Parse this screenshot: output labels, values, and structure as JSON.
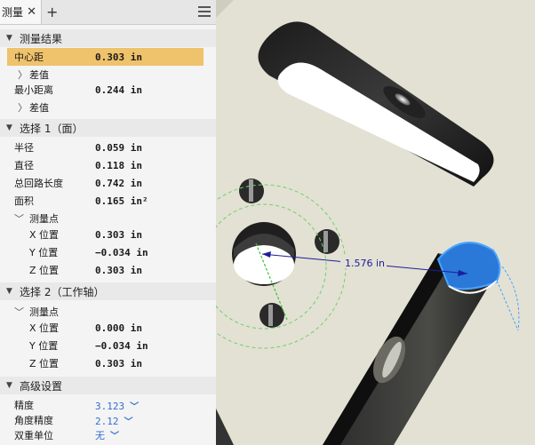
{
  "tab": {
    "label": "测量",
    "close": "✕",
    "add": "+"
  },
  "results": {
    "title": "测量结果",
    "center_distance_label": "中心距",
    "center_distance_value": "0.303 in",
    "diff_label_1": "差值",
    "min_distance_label": "最小距离",
    "min_distance_value": "0.244 in",
    "diff_label_2": "差值"
  },
  "sel1": {
    "title": "选择 1（面）",
    "radius_label": "半径",
    "radius_value": "0.059 in",
    "diameter_label": "直径",
    "diameter_value": "0.118 in",
    "loop_label": "总回路长度",
    "loop_value": "0.742 in",
    "area_label": "面积",
    "area_value": "0.165 in²",
    "points_label": "测量点",
    "x_label": "X 位置",
    "x_value": "0.303 in",
    "y_label": "Y 位置",
    "y_value": "−0.034 in",
    "z_label": "Z 位置",
    "z_value": "0.303 in"
  },
  "sel2": {
    "title": "选择 2（工作轴）",
    "points_label": "测量点",
    "x_label": "X 位置",
    "x_value": "0.000 in",
    "y_label": "Y 位置",
    "y_value": "−0.034 in",
    "z_label": "Z 位置",
    "z_value": "0.303 in"
  },
  "advanced": {
    "title": "高级设置",
    "precision_label": "精度",
    "precision_value": "3.123",
    "angle_precision_label": "角度精度",
    "angle_precision_value": "2.12",
    "dual_unit_label": "双重单位",
    "dual_unit_value": "无"
  },
  "viewport": {
    "dimension_label": "1.576 in",
    "colors": {
      "background": "#d8d6c6",
      "plate": "#e5e3d6",
      "accent": "#2a78d8",
      "dimension": "#1d1d9a"
    }
  }
}
